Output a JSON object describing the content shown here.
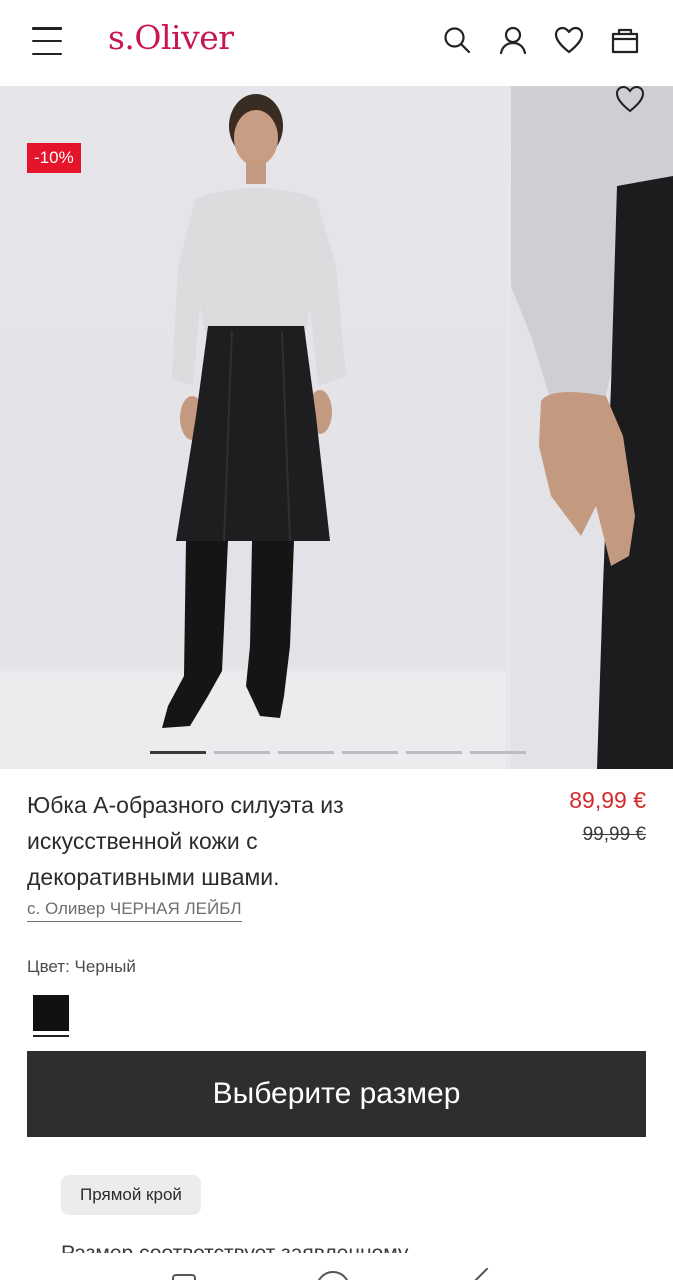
{
  "header": {
    "logo": "s.Oliver",
    "icons": [
      "menu-icon",
      "search-icon",
      "account-icon",
      "wishlist-icon",
      "bag-icon"
    ]
  },
  "gallery": {
    "sale_badge": "-10%",
    "slide_count": 6,
    "active_slide": 1
  },
  "product": {
    "title": "Юбка А-образного силуэта из искусственной кожи с декоративными швами.",
    "price_current": "89,99 €",
    "price_old": "99,99 €",
    "brand": "с. Оливер ЧЕРНАЯ ЛЕЙБЛ",
    "color_label": "Цвет: Черный",
    "color_swatch": "#111111",
    "size_button": "Выберите размер",
    "fit_chip": "Прямой крой",
    "fit_text": "Размер соответствует заявленному"
  },
  "colors": {
    "brand": "#c8174f",
    "sale": "#e4142b",
    "price_red": "#d42a2a",
    "button_dark": "#2e2e2e"
  }
}
